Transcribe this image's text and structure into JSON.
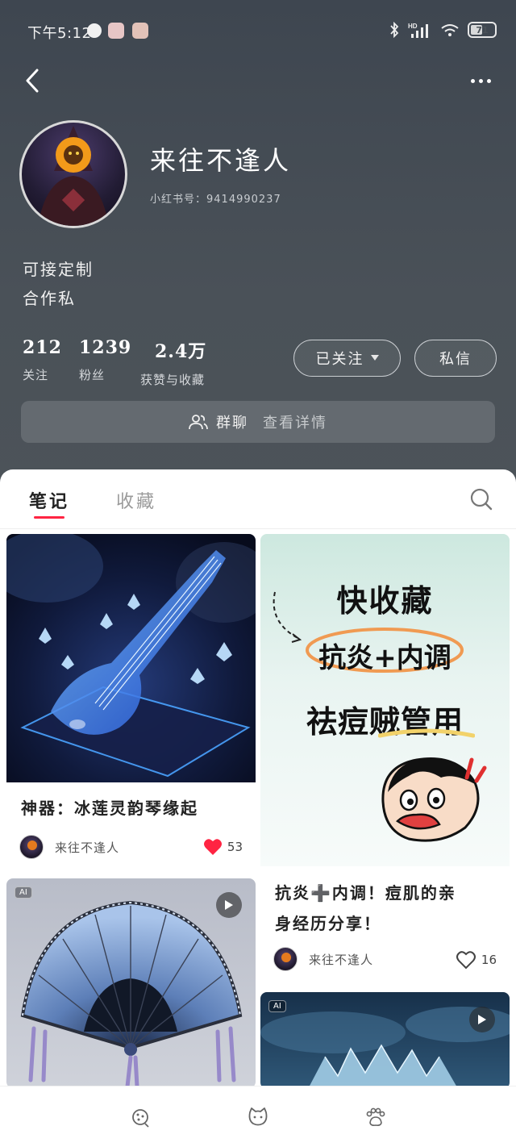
{
  "status_bar": {
    "time": "下午5:12",
    "battery": "71"
  },
  "profile": {
    "name": "来往不逢人",
    "id_label": "小红书号：9414990237",
    "bio_lines": [
      "可接定制",
      "合作私"
    ]
  },
  "stats": [
    {
      "value": "212",
      "label": "关注"
    },
    {
      "value": "1239",
      "label": "粉丝"
    },
    {
      "value": "2.4万",
      "label": "获赞与收藏"
    }
  ],
  "actions": {
    "follow_label": "已关注",
    "message_label": "私信"
  },
  "group_chat": {
    "label": "群聊",
    "detail": "查看详情"
  },
  "tabs": {
    "notes": "笔记",
    "favorites": "收藏"
  },
  "notes": [
    {
      "title": "神器：冰莲灵韵琴缘起",
      "author": "来往不逢人",
      "likes": "53",
      "liked": true
    },
    {
      "cover_lines": [
        "快收藏",
        "抗炎+内调",
        "祛痘贼管用"
      ],
      "title_lines": [
        "抗炎➕内调！痘肌的亲",
        "身经历分享！"
      ],
      "author": "来往不逢人",
      "likes": "16",
      "liked": false
    },
    {
      "badge": "AI",
      "has_video": true
    },
    {
      "badge": "AI",
      "has_video": true
    }
  ],
  "colors": {
    "accent": "#ff2442",
    "header_bg": "#4a5158"
  },
  "bottom_nav_icons": [
    "cookie-icon",
    "cat-icon",
    "paw-icon"
  ]
}
